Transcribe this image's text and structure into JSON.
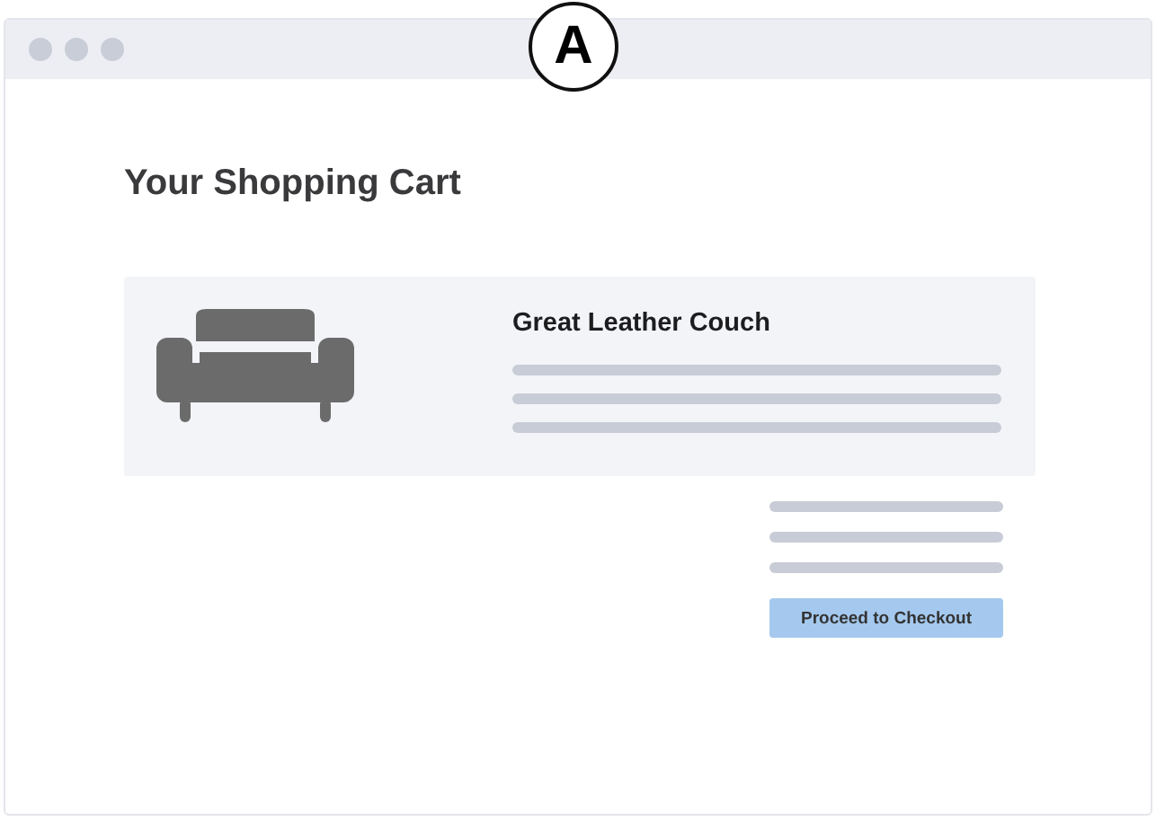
{
  "badge": {
    "label": "A"
  },
  "page": {
    "heading": "Your Shopping Cart"
  },
  "cart_item": {
    "name": "Great Leather Couch"
  },
  "checkout_button": {
    "label": "Proceed to Checkout"
  }
}
